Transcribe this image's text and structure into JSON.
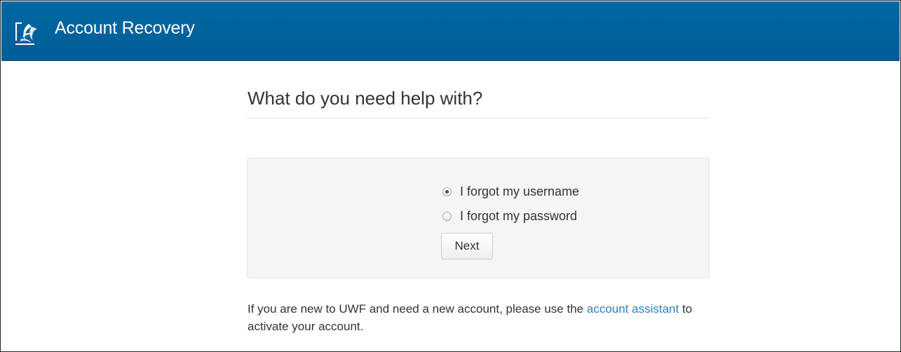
{
  "header": {
    "title": "Account Recovery",
    "logo_icon": "uwf-logo-icon",
    "background_color": "#0065a0"
  },
  "main": {
    "heading": "What do you need help with?",
    "options": [
      {
        "label": "I forgot my username",
        "selected": true
      },
      {
        "label": "I forgot my password",
        "selected": false
      }
    ],
    "next_label": "Next",
    "footer": {
      "text_before": "If you are new to UWF and need a new account, please use the ",
      "link_text": "account assistant",
      "text_after": " to activate your account.",
      "link_color": "#2a7fc1"
    }
  }
}
